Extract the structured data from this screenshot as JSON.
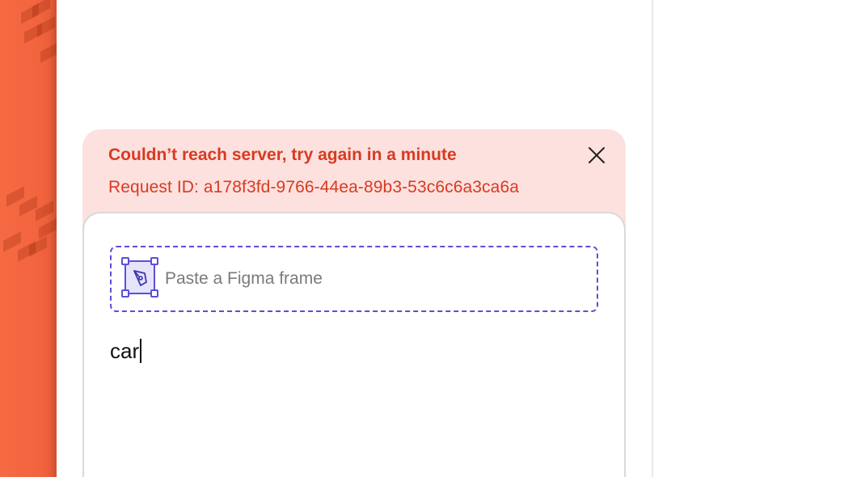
{
  "error": {
    "title": "Couldn’t reach server, try again in a minute",
    "request_id": "Request ID: a178f3fd-9766-44ea-89b3-53c6c6a3ca6a",
    "color": "#d83a22",
    "background": "#fde1de",
    "close_icon": "close-icon"
  },
  "figma_input": {
    "placeholder": "Paste a Figma frame",
    "icon": "figma-frame-icon",
    "border_color": "#5a4fd8"
  },
  "prompt": {
    "value": "car"
  },
  "colors": {
    "accent_orange": "#f2643e"
  }
}
